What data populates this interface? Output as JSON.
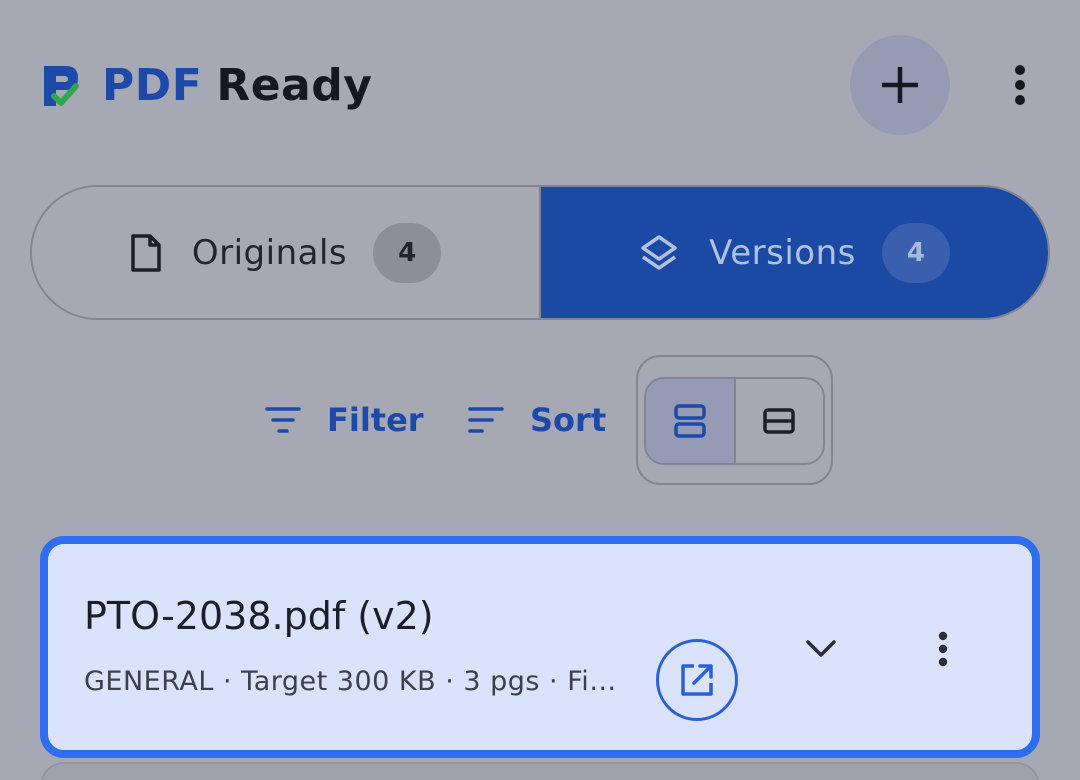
{
  "header": {
    "title_part1": "PDF",
    "title_part2": "Ready",
    "logo_icon": "pdf-ready-logo-icon",
    "add_icon": "plus-icon",
    "more_icon": "more-vertical-icon"
  },
  "tabs": [
    {
      "label": "Originals",
      "count": "4",
      "icon": "document-icon",
      "selected": false
    },
    {
      "label": "Versions",
      "count": "4",
      "icon": "layers-icon",
      "selected": true
    }
  ],
  "toolbar": {
    "filter_label": "Filter",
    "sort_label": "Sort",
    "view_options": [
      "expanded-view-icon",
      "compact-view-icon"
    ],
    "active_view": "expanded"
  },
  "cards": [
    {
      "title": "PTO-2038.pdf (v2)",
      "meta": "GENERAL · Target 300 KB · 3 pgs · Fi…",
      "open_icon": "open-external-icon",
      "expand_icon": "chevron-down-icon",
      "more_icon": "more-vertical-icon"
    }
  ],
  "colors": {
    "brand_blue": "#1d4aa8",
    "accent_border": "#2f6ef0",
    "selected_tab": "#1a4aa4"
  }
}
